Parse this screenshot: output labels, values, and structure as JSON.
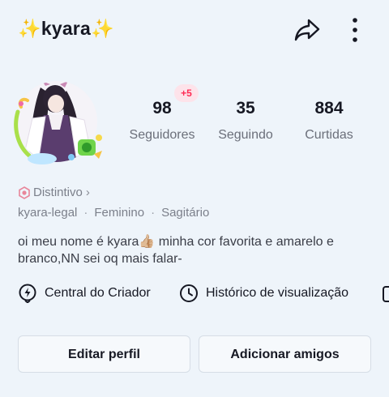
{
  "header": {
    "username": "✨kyara✨",
    "share_icon": "share-arrow-icon",
    "more_icon": "more-vertical-icon"
  },
  "profile": {
    "avatar_icon": "anime-character-avatar"
  },
  "stats": [
    {
      "value": "98",
      "label": "Seguidores",
      "badge": "+5"
    },
    {
      "value": "35",
      "label": "Seguindo"
    },
    {
      "value": "884",
      "label": "Curtidas"
    }
  ],
  "distintivo": {
    "label": "Distintivo",
    "chevron": "›"
  },
  "meta": {
    "handle": "kyara-legal",
    "gender": "Feminino",
    "sign": "Sagitário",
    "separator": "·"
  },
  "bio": "oi meu nome é kyara👍🏼 minha cor favorita e amarelo e branco,NN sei oq mais falar-",
  "links": [
    {
      "label": "Central do Criador",
      "icon": "creator-center-icon"
    },
    {
      "label": "Histórico de visualização",
      "icon": "clock-history-icon"
    }
  ],
  "buttons": {
    "edit": "Editar perfil",
    "add_friends": "Adicionar amigos"
  },
  "colors": {
    "background": "#eef4fa",
    "accent": "#fe2c55",
    "text": "#161823",
    "muted": "#7b7f8a"
  }
}
